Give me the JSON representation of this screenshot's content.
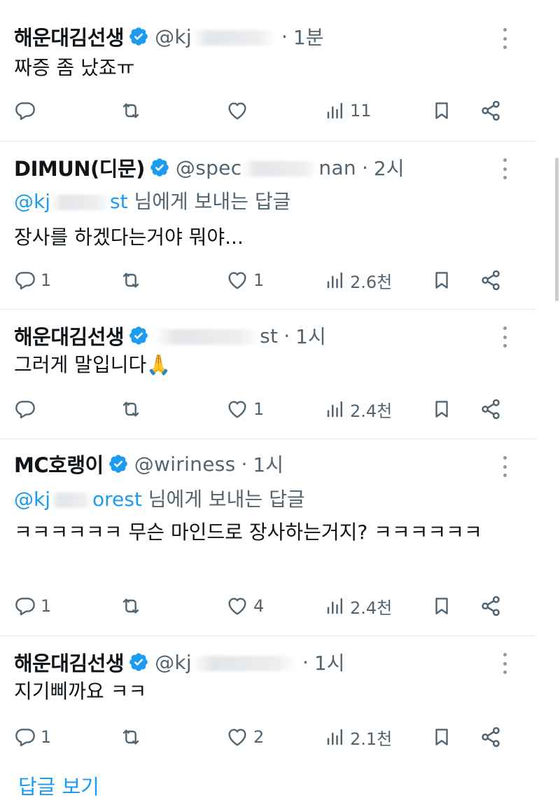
{
  "tweets": [
    {
      "name": "해운대김선생",
      "handle_prefix": "@kj",
      "handle_suffix": "",
      "time": "1분",
      "reply_to": null,
      "text": "짜증 좀 났죠ㅠ",
      "counts": {
        "reply": "",
        "retweet": "",
        "like": "",
        "views": "11"
      }
    },
    {
      "name": "DIMUN(디문)",
      "handle_prefix": "@spec",
      "handle_suffix": "nan",
      "time": "2시",
      "reply_to": {
        "mention_prefix": "@kj",
        "mention_suffix": "st",
        "label": "님에게 보내는 답글"
      },
      "text": "장사를 하겠다는거야 뭐야...",
      "counts": {
        "reply": "1",
        "retweet": "",
        "like": "1",
        "views": "2.6천"
      }
    },
    {
      "name": "해운대김선생",
      "handle_prefix": "",
      "handle_suffix": "st",
      "time": "1시",
      "reply_to": null,
      "text": "그러게 말입니다🙏",
      "counts": {
        "reply": "",
        "retweet": "",
        "like": "1",
        "views": "2.4천"
      }
    },
    {
      "name": "MC호랭이",
      "handle_prefix": "@wiriness",
      "handle_suffix": "",
      "time": "1시",
      "reply_to": {
        "mention_prefix": "@kj",
        "mention_suffix": "orest",
        "label": "님에게 보내는 답글"
      },
      "text": "ㅋㅋㅋㅋㅋㅋ 무슨 마인드로 장사하는거지? ㅋㅋㅋㅋㅋㅋ",
      "counts": {
        "reply": "1",
        "retweet": "",
        "like": "4",
        "views": "2.4천"
      }
    },
    {
      "name": "해운대김선생",
      "handle_prefix": "@kj",
      "handle_suffix": "",
      "time": "1시",
      "reply_to": null,
      "text": "지기삐까요 ㅋㅋ",
      "counts": {
        "reply": "1",
        "retweet": "",
        "like": "2",
        "views": "2.1천"
      }
    }
  ],
  "footer": {
    "show_replies": "답글 보기"
  },
  "colors": {
    "accent": "#1d9bf0",
    "secondary_text": "#536471",
    "primary_text": "#0f1419",
    "divider": "#e6e9ec"
  },
  "icons": [
    "verified-badge-icon",
    "more-icon",
    "reply-icon",
    "retweet-icon",
    "like-icon",
    "views-icon",
    "bookmark-icon",
    "share-icon"
  ]
}
